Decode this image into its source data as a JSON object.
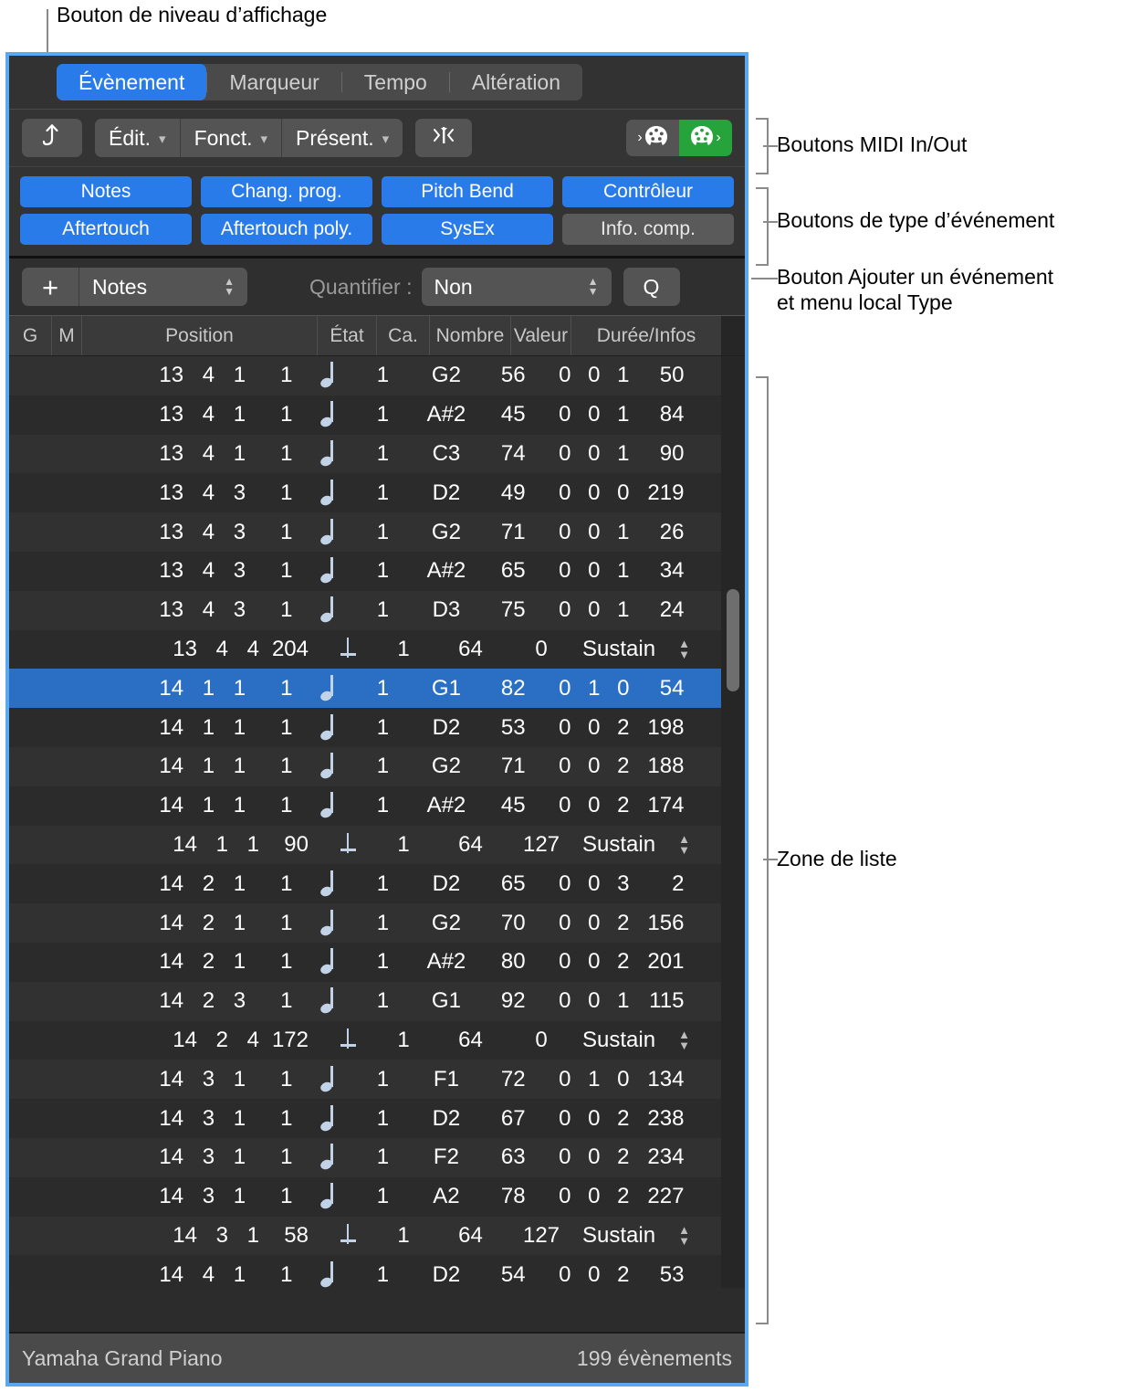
{
  "annotations": [
    {
      "id": "display-level",
      "text": "Bouton de niveau d’affichage"
    },
    {
      "id": "midi-inout",
      "text": "Boutons MIDI In/Out"
    },
    {
      "id": "event-type",
      "text": "Boutons de type d’événement"
    },
    {
      "id": "add-event",
      "text": "Bouton Ajouter un événement\net menu local Type"
    },
    {
      "id": "list-area",
      "text": "Zone de liste"
    }
  ],
  "tabs": [
    {
      "label": "Évènement",
      "active": true
    },
    {
      "label": "Marqueur",
      "active": false
    },
    {
      "label": "Tempo",
      "active": false
    },
    {
      "label": "Altération",
      "active": false
    }
  ],
  "toolbar": {
    "hierarchy_icon": "up-arrow-hierarchy-icon",
    "menus": [
      "Édit.",
      "Fonct.",
      "Présent."
    ],
    "link_icon": "note-link-icon",
    "midi_in_label": "midi-in-button",
    "midi_out_label": "midi-out-button"
  },
  "event_types": [
    {
      "label": "Notes",
      "on": true
    },
    {
      "label": "Chang. prog.",
      "on": true
    },
    {
      "label": "Pitch Bend",
      "on": true
    },
    {
      "label": "Contrôleur",
      "on": true
    },
    {
      "label": "Aftertouch",
      "on": true
    },
    {
      "label": "Aftertouch poly.",
      "on": true
    },
    {
      "label": "SysEx",
      "on": true
    },
    {
      "label": "Info. comp.",
      "on": false
    }
  ],
  "add_row": {
    "plus": "+",
    "type_value": "Notes",
    "quantize_label": "Quantifier :",
    "quantize_value": "Non",
    "q_button": "Q"
  },
  "table": {
    "headers": [
      "G",
      "M",
      "Position",
      "État",
      "Ca.",
      "Nombre",
      "Valeur",
      "Durée/Infos"
    ],
    "rows": [
      {
        "pos": [
          "13",
          "4",
          "1"
        ],
        "tick": "1",
        "glyph": "note",
        "ch": "1",
        "num": "G2",
        "val": "56",
        "dur": [
          "0",
          "0",
          "1",
          "50"
        ],
        "info": null,
        "selected": false
      },
      {
        "pos": [
          "13",
          "4",
          "1"
        ],
        "tick": "1",
        "glyph": "note",
        "ch": "1",
        "num": "A#2",
        "val": "45",
        "dur": [
          "0",
          "0",
          "1",
          "84"
        ],
        "info": null,
        "selected": false
      },
      {
        "pos": [
          "13",
          "4",
          "1"
        ],
        "tick": "1",
        "glyph": "note",
        "ch": "1",
        "num": "C3",
        "val": "74",
        "dur": [
          "0",
          "0",
          "1",
          "90"
        ],
        "info": null,
        "selected": false
      },
      {
        "pos": [
          "13",
          "4",
          "3"
        ],
        "tick": "1",
        "glyph": "note",
        "ch": "1",
        "num": "D2",
        "val": "49",
        "dur": [
          "0",
          "0",
          "0",
          "219"
        ],
        "info": null,
        "selected": false
      },
      {
        "pos": [
          "13",
          "4",
          "3"
        ],
        "tick": "1",
        "glyph": "note",
        "ch": "1",
        "num": "G2",
        "val": "71",
        "dur": [
          "0",
          "0",
          "1",
          "26"
        ],
        "info": null,
        "selected": false
      },
      {
        "pos": [
          "13",
          "4",
          "3"
        ],
        "tick": "1",
        "glyph": "note",
        "ch": "1",
        "num": "A#2",
        "val": "65",
        "dur": [
          "0",
          "0",
          "1",
          "34"
        ],
        "info": null,
        "selected": false
      },
      {
        "pos": [
          "13",
          "4",
          "3"
        ],
        "tick": "1",
        "glyph": "note",
        "ch": "1",
        "num": "D3",
        "val": "75",
        "dur": [
          "0",
          "0",
          "1",
          "24"
        ],
        "info": null,
        "selected": false
      },
      {
        "pos": [
          "13",
          "4",
          "4"
        ],
        "tick": "204",
        "glyph": "ctrl",
        "ch": "1",
        "num": "64",
        "val": "0",
        "dur": null,
        "info": "Sustain",
        "selected": false
      },
      {
        "pos": [
          "14",
          "1",
          "1"
        ],
        "tick": "1",
        "glyph": "note",
        "ch": "1",
        "num": "G1",
        "val": "82",
        "dur": [
          "0",
          "1",
          "0",
          "54"
        ],
        "info": null,
        "selected": true
      },
      {
        "pos": [
          "14",
          "1",
          "1"
        ],
        "tick": "1",
        "glyph": "note",
        "ch": "1",
        "num": "D2",
        "val": "53",
        "dur": [
          "0",
          "0",
          "2",
          "198"
        ],
        "info": null,
        "selected": false
      },
      {
        "pos": [
          "14",
          "1",
          "1"
        ],
        "tick": "1",
        "glyph": "note",
        "ch": "1",
        "num": "G2",
        "val": "71",
        "dur": [
          "0",
          "0",
          "2",
          "188"
        ],
        "info": null,
        "selected": false
      },
      {
        "pos": [
          "14",
          "1",
          "1"
        ],
        "tick": "1",
        "glyph": "note",
        "ch": "1",
        "num": "A#2",
        "val": "45",
        "dur": [
          "0",
          "0",
          "2",
          "174"
        ],
        "info": null,
        "selected": false
      },
      {
        "pos": [
          "14",
          "1",
          "1"
        ],
        "tick": "90",
        "glyph": "ctrl",
        "ch": "1",
        "num": "64",
        "val": "127",
        "dur": null,
        "info": "Sustain",
        "selected": false
      },
      {
        "pos": [
          "14",
          "2",
          "1"
        ],
        "tick": "1",
        "glyph": "note",
        "ch": "1",
        "num": "D2",
        "val": "65",
        "dur": [
          "0",
          "0",
          "3",
          "2"
        ],
        "info": null,
        "selected": false
      },
      {
        "pos": [
          "14",
          "2",
          "1"
        ],
        "tick": "1",
        "glyph": "note",
        "ch": "1",
        "num": "G2",
        "val": "70",
        "dur": [
          "0",
          "0",
          "2",
          "156"
        ],
        "info": null,
        "selected": false
      },
      {
        "pos": [
          "14",
          "2",
          "1"
        ],
        "tick": "1",
        "glyph": "note",
        "ch": "1",
        "num": "A#2",
        "val": "80",
        "dur": [
          "0",
          "0",
          "2",
          "201"
        ],
        "info": null,
        "selected": false
      },
      {
        "pos": [
          "14",
          "2",
          "3"
        ],
        "tick": "1",
        "glyph": "note",
        "ch": "1",
        "num": "G1",
        "val": "92",
        "dur": [
          "0",
          "0",
          "1",
          "115"
        ],
        "info": null,
        "selected": false
      },
      {
        "pos": [
          "14",
          "2",
          "4"
        ],
        "tick": "172",
        "glyph": "ctrl",
        "ch": "1",
        "num": "64",
        "val": "0",
        "dur": null,
        "info": "Sustain",
        "selected": false
      },
      {
        "pos": [
          "14",
          "3",
          "1"
        ],
        "tick": "1",
        "glyph": "note",
        "ch": "1",
        "num": "F1",
        "val": "72",
        "dur": [
          "0",
          "1",
          "0",
          "134"
        ],
        "info": null,
        "selected": false
      },
      {
        "pos": [
          "14",
          "3",
          "1"
        ],
        "tick": "1",
        "glyph": "note",
        "ch": "1",
        "num": "D2",
        "val": "67",
        "dur": [
          "0",
          "0",
          "2",
          "238"
        ],
        "info": null,
        "selected": false
      },
      {
        "pos": [
          "14",
          "3",
          "1"
        ],
        "tick": "1",
        "glyph": "note",
        "ch": "1",
        "num": "F2",
        "val": "63",
        "dur": [
          "0",
          "0",
          "2",
          "234"
        ],
        "info": null,
        "selected": false
      },
      {
        "pos": [
          "14",
          "3",
          "1"
        ],
        "tick": "1",
        "glyph": "note",
        "ch": "1",
        "num": "A2",
        "val": "78",
        "dur": [
          "0",
          "0",
          "2",
          "227"
        ],
        "info": null,
        "selected": false
      },
      {
        "pos": [
          "14",
          "3",
          "1"
        ],
        "tick": "58",
        "glyph": "ctrl",
        "ch": "1",
        "num": "64",
        "val": "127",
        "dur": null,
        "info": "Sustain",
        "selected": false
      },
      {
        "pos": [
          "14",
          "4",
          "1"
        ],
        "tick": "1",
        "glyph": "note",
        "ch": "1",
        "num": "D2",
        "val": "54",
        "dur": [
          "0",
          "0",
          "2",
          "53"
        ],
        "info": null,
        "selected": false
      }
    ]
  },
  "footer": {
    "instrument": "Yamaha Grand Piano",
    "count": "199 évènements"
  },
  "colors": {
    "accent_blue": "#2a7bea",
    "selection_blue": "#2a6fc4",
    "midi_on_green": "#26a33a",
    "window_border": "#5ba7f0"
  }
}
